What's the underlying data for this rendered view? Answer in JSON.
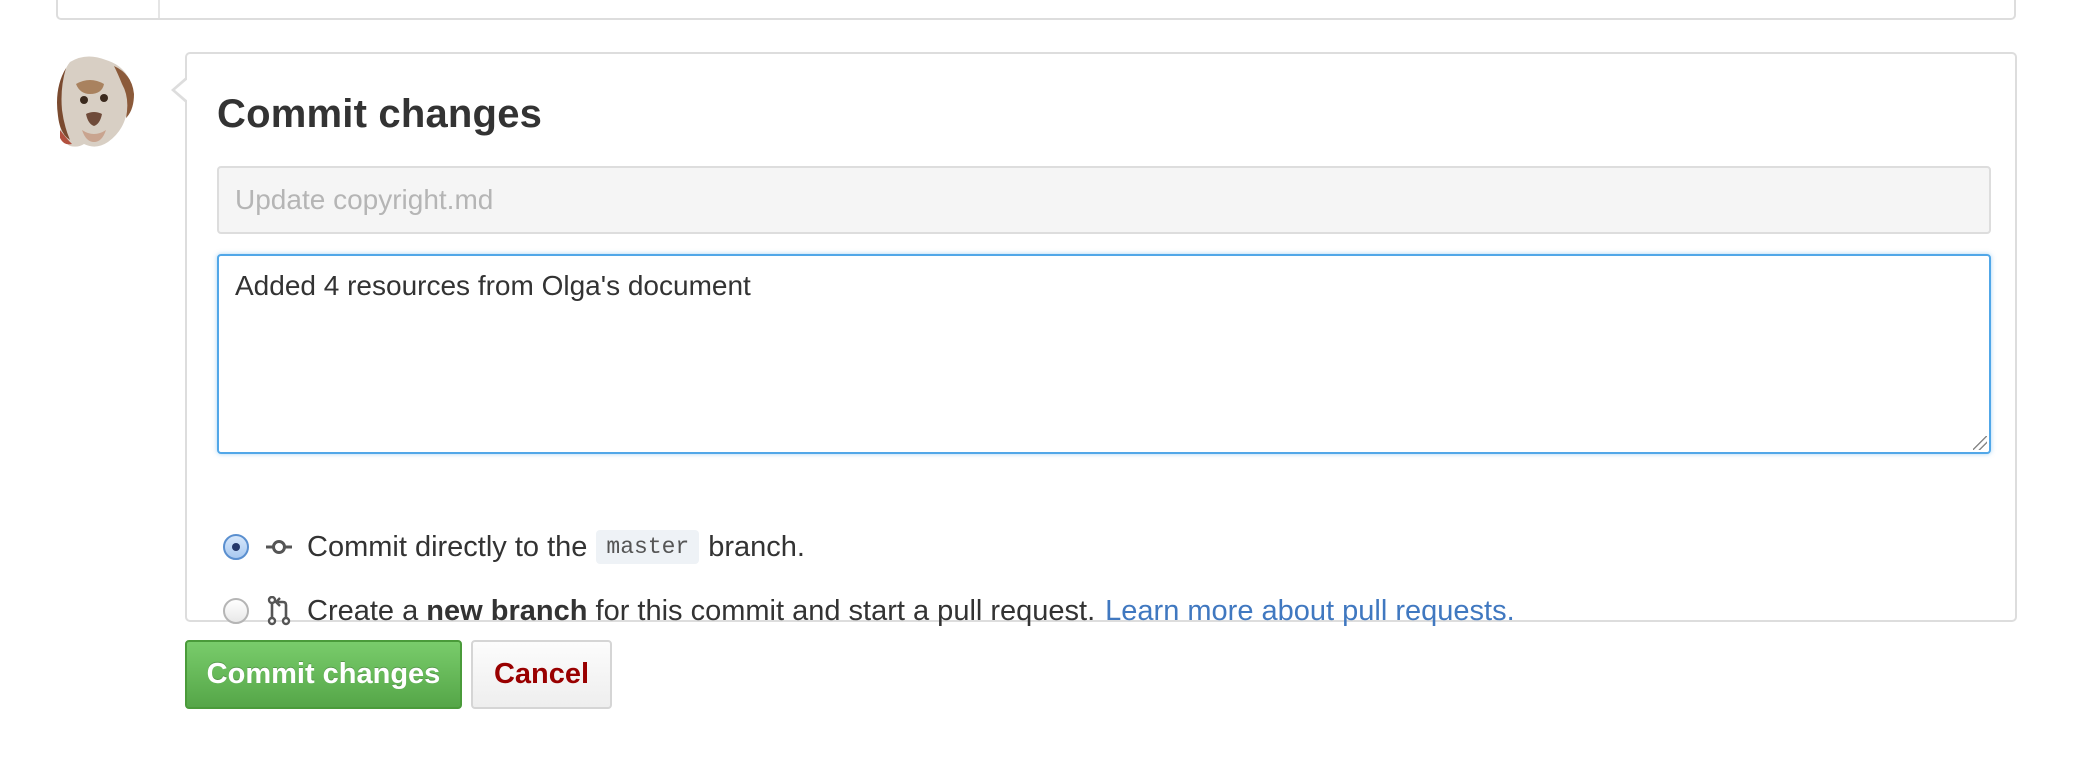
{
  "form": {
    "title": "Commit changes",
    "summary_placeholder": "Update copyright.md",
    "summary_value": "",
    "description_value": "Added 4 resources from Olga's document"
  },
  "options": {
    "direct": {
      "text_before": "Commit directly to the",
      "branch_name": "master",
      "text_after": "branch.",
      "checked": true,
      "icon": "git-commit-icon"
    },
    "new_branch": {
      "text_before": "Create a",
      "bold_text": "new branch",
      "text_after": "for this commit and start a pull request.",
      "link_text": "Learn more about pull requests.",
      "checked": false,
      "icon": "git-pull-request-icon"
    }
  },
  "buttons": {
    "commit_label": "Commit changes",
    "cancel_label": "Cancel"
  },
  "colors": {
    "commit_green": "#55a648",
    "cancel_red": "#990000",
    "link_blue": "#4078c0",
    "focus_blue": "#51a7e8"
  }
}
